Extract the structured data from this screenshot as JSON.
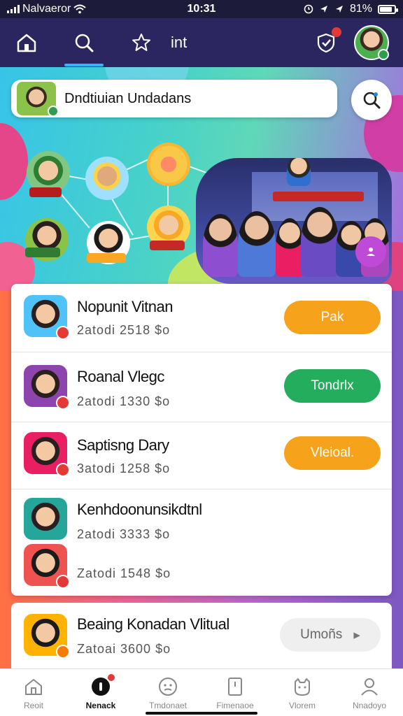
{
  "status_bar": {
    "carrier": "Nalvaeror",
    "time": "10:31",
    "battery": "81%"
  },
  "top_nav": {
    "tab_label": "int"
  },
  "search": {
    "text": "Dndtiuian Undadans"
  },
  "list": [
    {
      "name": "Nopunit Vitnan",
      "meta": "2atodi  2518  $o",
      "button": "Pak",
      "button_color": "#f7a21b"
    },
    {
      "name": "Roanal Vlegc",
      "meta": "2atodi  1330  $o",
      "button": "Tondrlx",
      "button_color": "#23ad5c"
    },
    {
      "name": "Saptisng Dary",
      "meta": "3atodi  1258  $o",
      "button": "Vleioal.",
      "button_color": "#f7a21b"
    },
    {
      "name": "Kenhdoonunsikdtnl",
      "meta": "2atodi  3333  $o",
      "button": "",
      "button_color": ""
    },
    {
      "name": "",
      "meta": "Zatodi  1548  $o",
      "button": "",
      "button_color": ""
    }
  ],
  "second_card": {
    "name": "Beaing Konadan Vlitual",
    "meta": "Zatoai  3600  $o",
    "button": "Umoñs"
  },
  "bottom_nav": [
    {
      "label": "Reoit",
      "icon": "home-icon"
    },
    {
      "label": "Nenack",
      "icon": "record-icon"
    },
    {
      "label": "Tmdonaet",
      "icon": "face-icon"
    },
    {
      "label": "Fimenaoe",
      "icon": "document-icon"
    },
    {
      "label": "Vlorem",
      "icon": "cat-icon"
    },
    {
      "label": "Nnadoyo",
      "icon": "person-icon"
    }
  ]
}
